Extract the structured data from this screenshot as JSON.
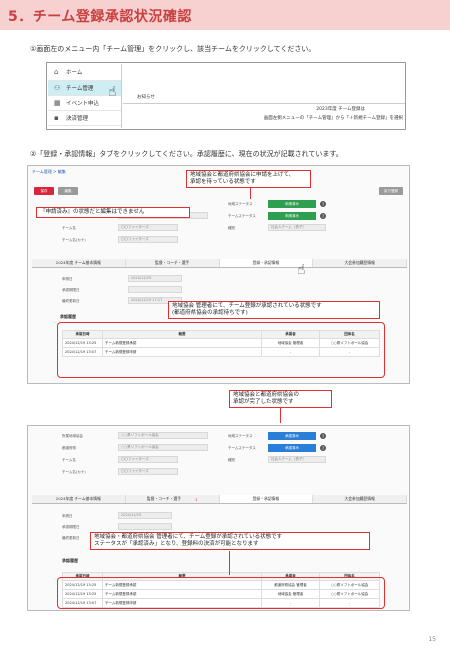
{
  "slide": {
    "title": "5．チーム登録承認状況確認",
    "page_number": "15"
  },
  "step1": {
    "text": "①画面左のメニュー内「チーム管理」をクリックし、該当チームをクリックしてください。",
    "menu": [
      "ホーム",
      "チーム管理",
      "イベント申込",
      "決済管理"
    ],
    "notice_label": "お知らせ",
    "notice_line1": "2023年度 チーム登録は",
    "notice_line2": "画面左側メニューの「チーム管理」から「＋新規チーム登録」を選択"
  },
  "step2": {
    "text": "②「登録・承認情報」タブをクリックしてください。承認履歴に、現在の状況が記載されています。"
  },
  "shot1": {
    "breadcrumb": "チーム管理 > 編集",
    "btn_save": "保存",
    "btn_edit": "編集",
    "btn_back": "戻り登録",
    "callout_top_1": "地域協会と都道府県協会に申請を上げて、",
    "callout_top_2": "承認を待っている状態です",
    "callout_left": "『申請済み』の状態だと編集はできません",
    "labels": [
      "所属地域",
      "都道府県",
      "チーム名",
      "チーム名(カナ)"
    ],
    "values": [
      "○○県ソフトボール協会",
      "○○県ソフトボール協会",
      "〇〇ファイターズ",
      "〇〇ファイターズ"
    ],
    "right_labels": [
      "地域ステータス",
      "チームステータス",
      "種別"
    ],
    "status1": "申請済み",
    "status2": "申請済み",
    "type_value": "社会人チーム（男子）",
    "tabs": [
      "2024年度 チーム基本情報",
      "監督・コーチ・選手",
      "登録・承認情報",
      "大会参加履歴情報"
    ],
    "field_labels": [
      "申請日",
      "承認期限日",
      "最終更新日"
    ],
    "field_values": [
      "2024/12/25",
      "",
      "2024/12/19 17:17"
    ],
    "callout_mid_1": "地域協会 管理者にて、チーム登録が承認されている状態です",
    "callout_mid_2": "(都道府県協会の承認待ちです)",
    "history_label": "承認履歴",
    "table_headers": [
      "承認日時",
      "概要",
      "承認者",
      "団体名"
    ],
    "rows": [
      [
        "2024/12/19 13:25",
        "チーム新規登録承認",
        "地域協会 管理者",
        "○○県ソフトボール協会"
      ],
      [
        "2024/12/19 13:07",
        "チーム新規登録申請",
        "-",
        "-"
      ]
    ]
  },
  "callout_between_1": "地域協会と都道府県協会の",
  "callout_between_2": "承認が完了した状態です",
  "shot2": {
    "labels": [
      "所属地域協会",
      "都道府県",
      "チーム名",
      "チーム名(カナ)"
    ],
    "values": [
      "○○県ソフトボール協会",
      "○○県ソフトボール協会",
      "〇〇ファイターズ",
      "〇〇ファイターズ"
    ],
    "right_labels": [
      "地域ステータス",
      "チームステータス",
      "種別"
    ],
    "status1": "承認済み",
    "status2": "承認済み",
    "type_value": "社会人チーム（男子）",
    "tabs": [
      "2024年度 チーム基本情報",
      "監督・コーチ・選手",
      "登録・承認情報",
      "大会参加履歴情報"
    ],
    "tab_badge": "1",
    "field_labels": [
      "申請日",
      "承認期限日",
      "最終更新日"
    ],
    "field_values": [
      "2024/12/25",
      "",
      ""
    ],
    "callout_1": "地域協会・都道府県協会 管理者にて、チーム登録が承認されている状態です",
    "callout_2": "ステータスが「承認済み」となり、登録料の決済が可能となります",
    "history_label": "承認履歴",
    "table_headers": [
      "承認日時",
      "概要",
      "承認者",
      "団体名"
    ],
    "rows": [
      [
        "2024/12/19 13:25",
        "チーム新規登録承認",
        "都道府県協会 管理者",
        "○○県ソフトボール協会"
      ],
      [
        "2024/12/19 13:25",
        "チーム新規登録承認",
        "地域協会 管理者",
        "○○県ソフトボール協会"
      ],
      [
        "2024/12/19 13:07",
        "チーム新規登録申請",
        "-",
        "-"
      ]
    ]
  },
  "icons": {
    "home": "home-icon",
    "team": "team-icon",
    "event": "calendar-icon",
    "pointer": "hand-pointer-icon",
    "help": "help-circle-icon"
  },
  "colors": {
    "header_bg": "#f7d0d0",
    "title": "#c94040",
    "status_green": "#2e9e4f",
    "status_blue": "#2a7ed8",
    "callout_red": "#e03030"
  }
}
